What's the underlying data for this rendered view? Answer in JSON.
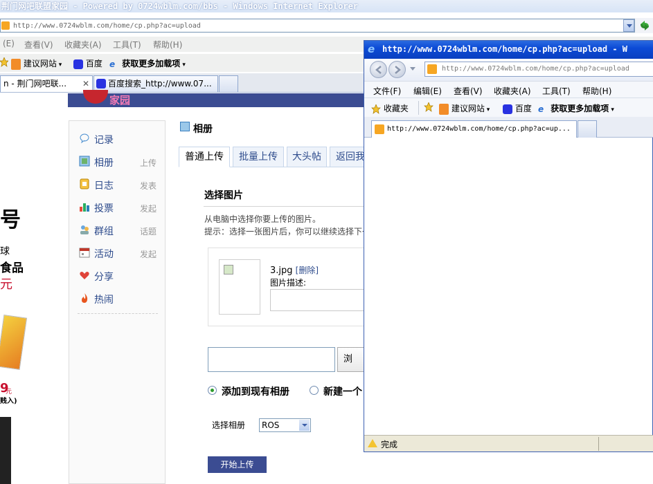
{
  "back_window": {
    "title": "荆门网吧联盟家园 - Powered by 0724wblm.com/bbs - Windows Internet Explorer",
    "address": "http://www.0724wblm.com/home/cp.php?ac=upload",
    "menu": [
      "(E)",
      "查看(V)",
      "收藏夹(A)",
      "工具(T)",
      "帮助(H)"
    ],
    "fav_items": [
      "建议网站",
      "百度",
      "获取更多加载项"
    ],
    "tabs": [
      "n - 荆门网吧联...",
      "百度搜索_http://www.07..."
    ],
    "logo_text": "家园",
    "ad": {
      "line1": "号",
      "line2": "球",
      "line3": "食品",
      "line4": "元",
      "price": "9",
      "price_unit": "元",
      "note": "贱入)"
    },
    "sidebar": [
      {
        "label": "记录",
        "sub": ""
      },
      {
        "label": "相册",
        "sub": "上传"
      },
      {
        "label": "日志",
        "sub": "发表"
      },
      {
        "label": "投票",
        "sub": "发起"
      },
      {
        "label": "群组",
        "sub": "话题"
      },
      {
        "label": "活动",
        "sub": "发起"
      },
      {
        "label": "分享",
        "sub": ""
      },
      {
        "label": "热闹",
        "sub": ""
      }
    ],
    "page_title": "相册",
    "page_tabs": [
      "普通上传",
      "批量上传",
      "大头帖",
      "返回我"
    ],
    "section_title": "选择图片",
    "hint1": "从电脑中选择你要上传的图片。",
    "hint2": "提示：选择一张图片后，你可以继续选择下一",
    "file_name": "3.jpg",
    "delete_label": "[删除]",
    "desc_label": "图片描述:",
    "browse_label": "浏览...",
    "radio_existing": "添加到现有相册",
    "radio_new": "新建一个",
    "select_album_label": "选择相册",
    "select_album_value": "ROS",
    "start_upload": "开始上传"
  },
  "front_window": {
    "title": "http://www.0724wblm.com/home/cp.php?ac=upload - W",
    "address": "http://www.0724wblm.com/home/cp.php?ac=upload",
    "menu": [
      "文件(F)",
      "编辑(E)",
      "查看(V)",
      "收藏夹(A)",
      "工具(T)",
      "帮助(H)"
    ],
    "favorites": "收藏夹",
    "fav_items": [
      "建议网站",
      "百度",
      "获取更多加载项"
    ],
    "tab": "http://www.0724wblm.com/home/cp.php?ac=up...",
    "status": "完成"
  },
  "colors": {
    "brand_blue": "#3b4c92",
    "link_blue": "#2d4b8c",
    "xp_title_blue": "#0c4bd6"
  }
}
